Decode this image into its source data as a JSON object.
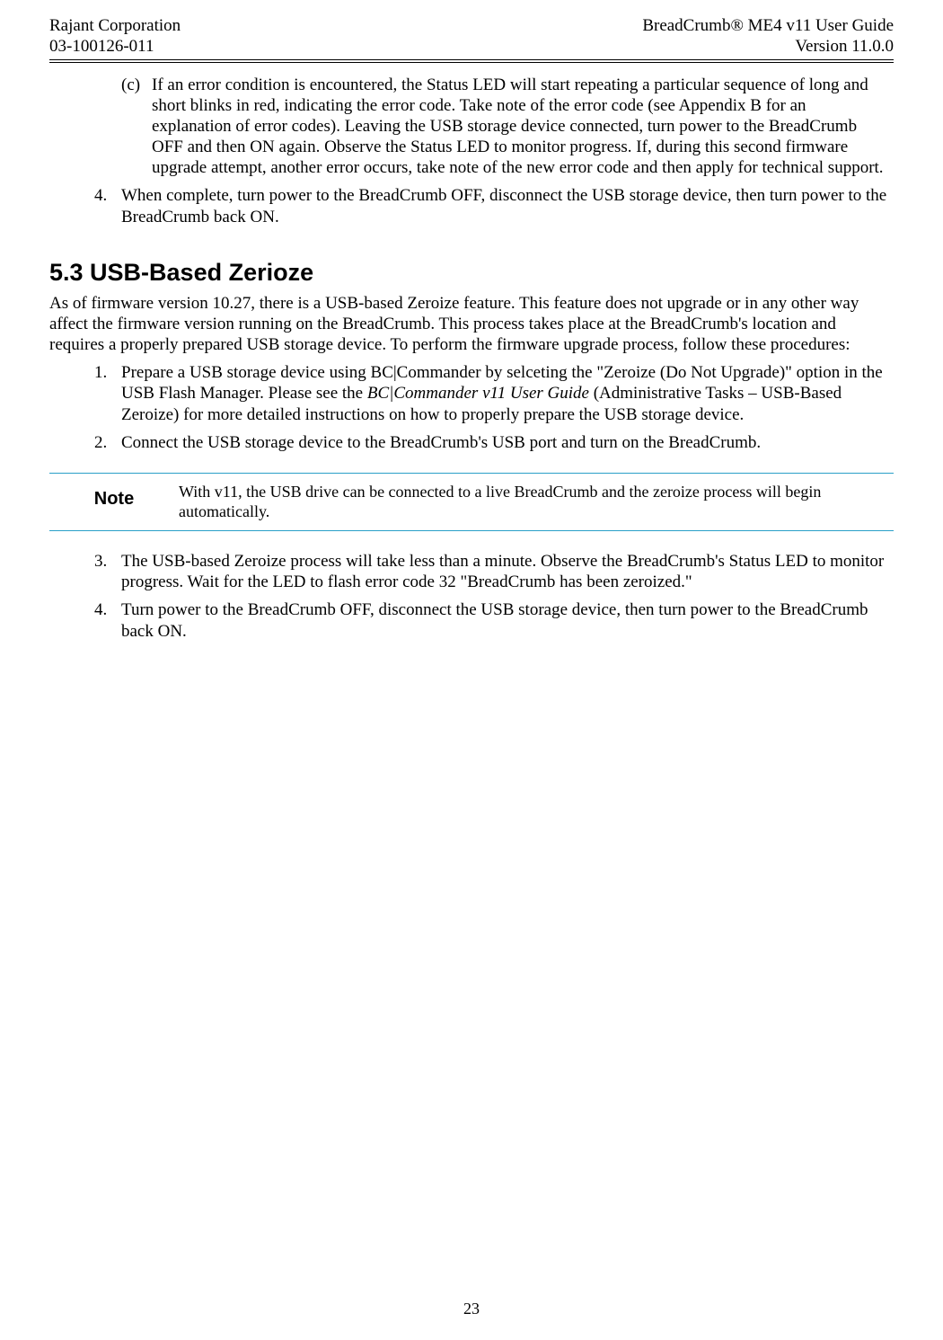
{
  "header": {
    "left_line1": "Rajant Corporation",
    "left_line2": "03-100126-011",
    "right_line1": "BreadCrumb® ME4 v11 User Guide",
    "right_line2": "Version 11.0.0"
  },
  "step3c": {
    "marker": "(c)",
    "text": "If an error condition is encountered, the Status LED will start repeating a particular sequence of long and short blinks in red, indicating the error code.  Take note of the error code (see Appendix B for an explanation of error codes).  Leaving the USB storage device connected, turn power to the BreadCrumb OFF and then ON again.  Observe the Status LED to monitor progress.  If, during this second firmware upgrade attempt, another error occurs, take note of the new error code and then apply for technical support."
  },
  "step4": {
    "marker": "4.",
    "text": "When complete, turn power to the BreadCrumb OFF, disconnect the USB storage device, then turn power to the BreadCrumb back ON."
  },
  "section53": {
    "heading": "5.3   USB-Based Zerioze",
    "intro": "As of firmware version 10.27, there is a USB-based Zeroize feature.  This feature does not upgrade or in any other way affect the firmware version running on the BreadCrumb.  This process takes place at the BreadCrumb's location and requires a properly prepared USB storage device.  To perform the firmware upgrade process, follow these procedures:",
    "step1": {
      "marker": "1.",
      "pre": "Prepare a USB storage device using BC|Commander by selceting the \"Zeroize (Do Not Upgrade)\" option in the USB Flash Manager.  Please see the ",
      "italic": "BC|Commander v11 User Guide",
      "post": " (Administrative Tasks – USB-Based Zeroize) for more detailed instructions on how to properly prepare the USB storage device."
    },
    "step2": {
      "marker": "2.",
      "text": "Connect the USB storage device to the BreadCrumb's USB port and turn on the BreadCrumb."
    },
    "note": {
      "label": "Note",
      "text": "With v11, the USB drive can be connected to a live BreadCrumb and the zeroize process will begin automatically."
    },
    "step3": {
      "marker": "3.",
      "text": "The USB-based Zeroize process will take less than a minute.  Observe the BreadCrumb's Status LED to monitor progress.  Wait for the LED to flash error code 32 \"BreadCrumb has been zeroized.\""
    },
    "step4": {
      "marker": "4.",
      "text": "Turn power to the BreadCrumb OFF, disconnect the USB storage device, then turn power to the BreadCrumb back ON."
    }
  },
  "page_number": "23"
}
